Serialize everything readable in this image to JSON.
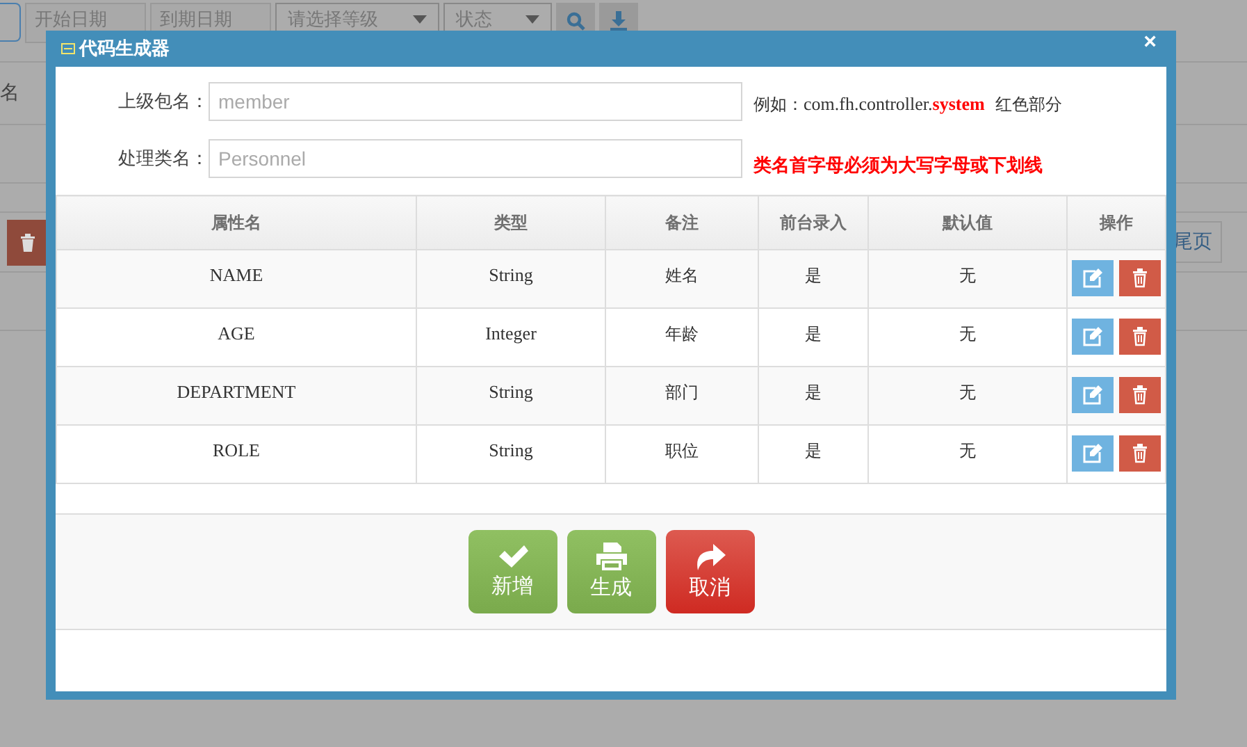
{
  "background": {
    "toolbar": {
      "start_date": "开始日期",
      "end_date": "到期日期",
      "level_select": "请选择等级",
      "status_select": "状态"
    },
    "column_header": "名",
    "pager": "尾页"
  },
  "dialog": {
    "title": "代码生成器",
    "close": "×",
    "fields": [
      {
        "label": "上级包名：",
        "placeholder": "member"
      },
      {
        "label": "处理类名：",
        "placeholder": "Personnel"
      }
    ],
    "package_hint": {
      "prefix": "例如：",
      "package": "com.fh.controller.",
      "highlight": "system",
      "suffix": "红色部分"
    },
    "class_hint": "类名首字母必须为大写字母或下划线",
    "table": {
      "columns": [
        "属性名",
        "类型",
        "备注",
        "前台录入",
        "默认值",
        "操作"
      ],
      "rows": [
        {
          "name": "NAME",
          "type": "String",
          "note": "姓名",
          "frontend": "是",
          "default": "无"
        },
        {
          "name": "AGE",
          "type": "Integer",
          "note": "年龄",
          "frontend": "是",
          "default": "无"
        },
        {
          "name": "DEPARTMENT",
          "type": "String",
          "note": "部门",
          "frontend": "是",
          "default": "无"
        },
        {
          "name": "ROLE",
          "type": "String",
          "note": "职位",
          "frontend": "是",
          "default": "无"
        }
      ]
    },
    "buttons": [
      {
        "kind": "confirm",
        "label": "新增"
      },
      {
        "kind": "print",
        "label": "生成"
      },
      {
        "kind": "cancel",
        "label": "取消"
      }
    ]
  }
}
